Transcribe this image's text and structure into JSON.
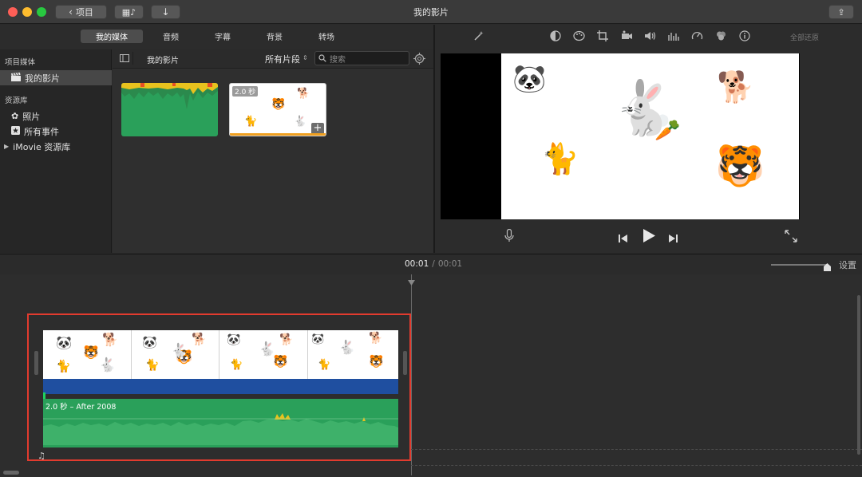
{
  "window": {
    "title": "我的影片",
    "back_label": "项目"
  },
  "tabs": [
    {
      "label": "我的媒体",
      "active": true
    },
    {
      "label": "音频",
      "active": false
    },
    {
      "label": "字幕",
      "active": false
    },
    {
      "label": "背景",
      "active": false
    },
    {
      "label": "转场",
      "active": false
    }
  ],
  "reset_all": "全部还原",
  "sidebar": {
    "section1": "项目媒体",
    "project_item": "我的影片",
    "section2": "资源库",
    "photos": "照片",
    "all_events": "所有事件",
    "library": "iMovie 资源库"
  },
  "browser": {
    "title": "我的影片",
    "filter": "所有片段",
    "search_placeholder": "搜索",
    "clip2_duration": "2.0 秒"
  },
  "timecode": {
    "current": "00:01",
    "separator": "/",
    "total": "00:01"
  },
  "settings_label": "设置",
  "audio_clip_label": "2.0 秒 – After 2008",
  "colors": {
    "accent_red": "#e23b2e",
    "audio_green": "#2aa05a",
    "video_blue": "#1f4fa0"
  }
}
